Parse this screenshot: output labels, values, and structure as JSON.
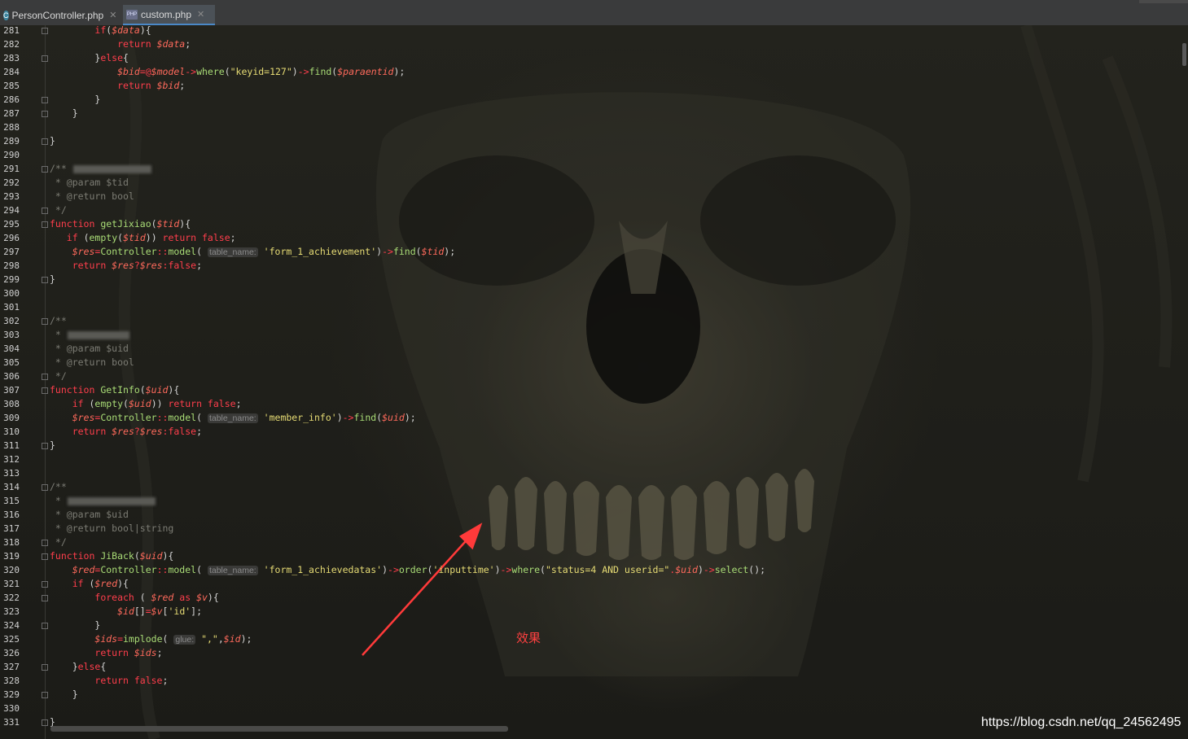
{
  "tabs": [
    {
      "label": "PersonController.php",
      "icon": "c-class-icon",
      "active": false
    },
    {
      "label": "custom.php",
      "icon": "php-file-icon",
      "active": true
    }
  ],
  "editor": {
    "lines": [
      {
        "n": "281",
        "segs": [
          [
            "",
            "        "
          ],
          [
            "kw",
            "if"
          ],
          [
            "",
            "("
          ],
          [
            "var",
            "$data"
          ],
          [
            "",
            "){"
          ]
        ],
        "fold": true
      },
      {
        "n": "282",
        "segs": [
          [
            "",
            "            "
          ],
          [
            "kw",
            "return "
          ],
          [
            "var",
            "$data"
          ],
          [
            "",
            ";"
          ]
        ]
      },
      {
        "n": "283",
        "segs": [
          [
            "",
            "        }"
          ],
          [
            "kw",
            "else"
          ],
          [
            "",
            "{"
          ]
        ],
        "fold": true
      },
      {
        "n": "284",
        "segs": [
          [
            "",
            "            "
          ],
          [
            "var",
            "$bid"
          ],
          [
            "op",
            "=@"
          ],
          [
            "var",
            "$model"
          ],
          [
            "op",
            "->"
          ],
          [
            "fn",
            "where"
          ],
          [
            "",
            "("
          ],
          [
            "str",
            "\"keyid=127\""
          ],
          [
            "",
            ")"
          ],
          [
            "op",
            "->"
          ],
          [
            "fn",
            "find"
          ],
          [
            "",
            "("
          ],
          [
            "var",
            "$paraentid"
          ],
          [
            "",
            ");"
          ]
        ]
      },
      {
        "n": "285",
        "segs": [
          [
            "",
            "            "
          ],
          [
            "kw",
            "return "
          ],
          [
            "var",
            "$bid"
          ],
          [
            "",
            ";"
          ]
        ]
      },
      {
        "n": "286",
        "segs": [
          [
            "",
            "        }"
          ]
        ],
        "fold": true
      },
      {
        "n": "287",
        "segs": [
          [
            "",
            "    }"
          ]
        ],
        "fold": true
      },
      {
        "n": "288",
        "segs": []
      },
      {
        "n": "289",
        "segs": [
          [
            "",
            "}"
          ]
        ],
        "fold": true
      },
      {
        "n": "290",
        "segs": []
      },
      {
        "n": "291",
        "segs": [
          [
            "cm",
            "/**"
          ]
        ],
        "blur": 96,
        "fold": true
      },
      {
        "n": "292",
        "segs": [
          [
            "cm",
            " * @param $tid"
          ]
        ]
      },
      {
        "n": "293",
        "segs": [
          [
            "cm",
            " * @return bool"
          ]
        ]
      },
      {
        "n": "294",
        "segs": [
          [
            "cm",
            " */"
          ]
        ],
        "fold": true
      },
      {
        "n": "295",
        "segs": [
          [
            "kw",
            "function "
          ],
          [
            "fn",
            "getJixiao"
          ],
          [
            "",
            "("
          ],
          [
            "var",
            "$tid"
          ],
          [
            "",
            "){"
          ]
        ],
        "fold": true
      },
      {
        "n": "296",
        "segs": [
          [
            "",
            "   "
          ],
          [
            "kw",
            "if "
          ],
          [
            "",
            "("
          ],
          [
            "fn",
            "empty"
          ],
          [
            "",
            "("
          ],
          [
            "var",
            "$tid"
          ],
          [
            "",
            ")) "
          ],
          [
            "kw",
            "return false"
          ],
          [
            "",
            ";"
          ]
        ]
      },
      {
        "n": "297",
        "segs": [
          [
            "",
            "    "
          ],
          [
            "var",
            "$res"
          ],
          [
            "op",
            "="
          ],
          [
            "fn",
            "Controller"
          ],
          [
            "op",
            "::"
          ],
          [
            "fn",
            "model"
          ],
          [
            "",
            "( "
          ],
          [
            "hint",
            "table_name:"
          ],
          [
            "",
            " "
          ],
          [
            "str",
            "'form_1_achievement'"
          ],
          [
            "",
            ")"
          ],
          [
            "op",
            "->"
          ],
          [
            "fn",
            "find"
          ],
          [
            "",
            "("
          ],
          [
            "var",
            "$tid"
          ],
          [
            "",
            ");"
          ]
        ]
      },
      {
        "n": "298",
        "segs": [
          [
            "",
            "    "
          ],
          [
            "kw",
            "return "
          ],
          [
            "var",
            "$res"
          ],
          [
            "op",
            "?"
          ],
          [
            "var",
            "$res"
          ],
          [
            "op",
            ":"
          ],
          [
            "kw",
            "false"
          ],
          [
            "",
            ";"
          ]
        ]
      },
      {
        "n": "299",
        "segs": [
          [
            "",
            "}"
          ]
        ],
        "fold": true
      },
      {
        "n": "300",
        "segs": []
      },
      {
        "n": "301",
        "segs": []
      },
      {
        "n": "302",
        "segs": [
          [
            "cm",
            "/**"
          ]
        ],
        "fold": true
      },
      {
        "n": "303",
        "segs": [
          [
            "cm",
            " *"
          ]
        ],
        "blur": 76
      },
      {
        "n": "304",
        "segs": [
          [
            "cm",
            " * @param $uid"
          ]
        ]
      },
      {
        "n": "305",
        "segs": [
          [
            "cm",
            " * @return bool"
          ]
        ]
      },
      {
        "n": "306",
        "segs": [
          [
            "cm",
            " */"
          ]
        ],
        "fold": true
      },
      {
        "n": "307",
        "segs": [
          [
            "kw",
            "function "
          ],
          [
            "fn",
            "GetInfo"
          ],
          [
            "",
            "("
          ],
          [
            "var",
            "$uid"
          ],
          [
            "",
            "){"
          ]
        ],
        "fold": true
      },
      {
        "n": "308",
        "segs": [
          [
            "",
            "    "
          ],
          [
            "kw",
            "if "
          ],
          [
            "",
            "("
          ],
          [
            "fn",
            "empty"
          ],
          [
            "",
            "("
          ],
          [
            "var",
            "$uid"
          ],
          [
            "",
            ")) "
          ],
          [
            "kw",
            "return false"
          ],
          [
            "",
            ";"
          ]
        ]
      },
      {
        "n": "309",
        "segs": [
          [
            "",
            "    "
          ],
          [
            "var",
            "$res"
          ],
          [
            "op",
            "="
          ],
          [
            "fn",
            "Controller"
          ],
          [
            "op",
            "::"
          ],
          [
            "fn",
            "model"
          ],
          [
            "",
            "( "
          ],
          [
            "hint",
            "table_name:"
          ],
          [
            "",
            " "
          ],
          [
            "str",
            "'member_info'"
          ],
          [
            "",
            ")"
          ],
          [
            "op",
            "->"
          ],
          [
            "fn",
            "find"
          ],
          [
            "",
            "("
          ],
          [
            "var",
            "$uid"
          ],
          [
            "",
            ");"
          ]
        ]
      },
      {
        "n": "310",
        "segs": [
          [
            "",
            "    "
          ],
          [
            "kw",
            "return "
          ],
          [
            "var",
            "$res"
          ],
          [
            "op",
            "?"
          ],
          [
            "var",
            "$res"
          ],
          [
            "op",
            ":"
          ],
          [
            "kw",
            "false"
          ],
          [
            "",
            ";"
          ]
        ]
      },
      {
        "n": "311",
        "segs": [
          [
            "",
            "}"
          ]
        ],
        "fold": true
      },
      {
        "n": "312",
        "segs": []
      },
      {
        "n": "313",
        "segs": []
      },
      {
        "n": "314",
        "segs": [
          [
            "cm",
            "/**"
          ]
        ],
        "fold": true
      },
      {
        "n": "315",
        "segs": [
          [
            "cm",
            " *"
          ]
        ],
        "blur": 108
      },
      {
        "n": "316",
        "segs": [
          [
            "cm",
            " * @param $uid"
          ]
        ]
      },
      {
        "n": "317",
        "segs": [
          [
            "cm",
            " * @return bool|string"
          ]
        ]
      },
      {
        "n": "318",
        "segs": [
          [
            "cm",
            " */"
          ]
        ],
        "fold": true
      },
      {
        "n": "319",
        "segs": [
          [
            "kw",
            "function "
          ],
          [
            "fn",
            "JiBack"
          ],
          [
            "",
            "("
          ],
          [
            "var",
            "$uid"
          ],
          [
            "",
            "){"
          ]
        ],
        "fold": true
      },
      {
        "n": "320",
        "segs": [
          [
            "",
            "    "
          ],
          [
            "var",
            "$red"
          ],
          [
            "op",
            "="
          ],
          [
            "fn",
            "Controller"
          ],
          [
            "op",
            "::"
          ],
          [
            "fn",
            "model"
          ],
          [
            "",
            "( "
          ],
          [
            "hint",
            "table_name:"
          ],
          [
            "",
            " "
          ],
          [
            "str",
            "'form_1_achievedatas'"
          ],
          [
            "",
            ")"
          ],
          [
            "op",
            "->"
          ],
          [
            "fn",
            "order"
          ],
          [
            "",
            "("
          ],
          [
            "str",
            "'inputtime'"
          ],
          [
            "",
            ")"
          ],
          [
            "op",
            "->"
          ],
          [
            "fn",
            "where"
          ],
          [
            "",
            "("
          ],
          [
            "str",
            "\"status=4 AND userid=\""
          ],
          [
            "op",
            "."
          ],
          [
            "var",
            "$uid"
          ],
          [
            "",
            ")"
          ],
          [
            "op",
            "->"
          ],
          [
            "fn",
            "select"
          ],
          [
            "",
            "();"
          ]
        ]
      },
      {
        "n": "321",
        "segs": [
          [
            "",
            "    "
          ],
          [
            "kw",
            "if "
          ],
          [
            "",
            "("
          ],
          [
            "var",
            "$red"
          ],
          [
            "",
            "){"
          ]
        ],
        "fold": true
      },
      {
        "n": "322",
        "segs": [
          [
            "",
            "        "
          ],
          [
            "kw",
            "foreach "
          ],
          [
            "",
            "( "
          ],
          [
            "var",
            "$red"
          ],
          [
            "",
            " "
          ],
          [
            "kw",
            "as "
          ],
          [
            "var",
            "$v"
          ],
          [
            "",
            "){"
          ]
        ],
        "fold": true
      },
      {
        "n": "323",
        "segs": [
          [
            "",
            "            "
          ],
          [
            "var",
            "$id"
          ],
          [
            "",
            "[]"
          ],
          [
            "op",
            "="
          ],
          [
            "var",
            "$v"
          ],
          [
            "",
            "["
          ],
          [
            "str",
            "'id'"
          ],
          [
            "",
            "];"
          ]
        ]
      },
      {
        "n": "324",
        "segs": [
          [
            "",
            "        }"
          ]
        ],
        "fold": true
      },
      {
        "n": "325",
        "segs": [
          [
            "",
            "        "
          ],
          [
            "var",
            "$ids"
          ],
          [
            "op",
            "="
          ],
          [
            "fn",
            "implode"
          ],
          [
            "",
            "( "
          ],
          [
            "hint",
            "glue:"
          ],
          [
            "",
            " "
          ],
          [
            "str",
            "\",\""
          ],
          [
            "",
            ","
          ],
          [
            "var",
            "$id"
          ],
          [
            "",
            ");"
          ]
        ]
      },
      {
        "n": "326",
        "segs": [
          [
            "",
            "        "
          ],
          [
            "kw",
            "return "
          ],
          [
            "var",
            "$ids"
          ],
          [
            "",
            ";"
          ]
        ]
      },
      {
        "n": "327",
        "segs": [
          [
            "",
            "    }"
          ],
          [
            "kw",
            "else"
          ],
          [
            "",
            "{"
          ]
        ],
        "fold": true
      },
      {
        "n": "328",
        "segs": [
          [
            "",
            "        "
          ],
          [
            "kw",
            "return false"
          ],
          [
            "",
            ";"
          ]
        ]
      },
      {
        "n": "329",
        "segs": [
          [
            "",
            "    }"
          ]
        ],
        "fold": true
      },
      {
        "n": "330",
        "segs": []
      },
      {
        "n": "331",
        "segs": [
          [
            "",
            "}"
          ]
        ],
        "fold": true
      }
    ]
  },
  "annotation": {
    "text": "效果",
    "color": "#ff4040"
  },
  "watermark": "https://blog.csdn.net/qq_24562495",
  "colors": {
    "keyword": "#ff3e4c",
    "variable": "#ff6a5c",
    "function": "#a9dc76",
    "string": "#e6db74",
    "comment": "#7c7c74",
    "active_tab_underline": "#4a88c7"
  }
}
